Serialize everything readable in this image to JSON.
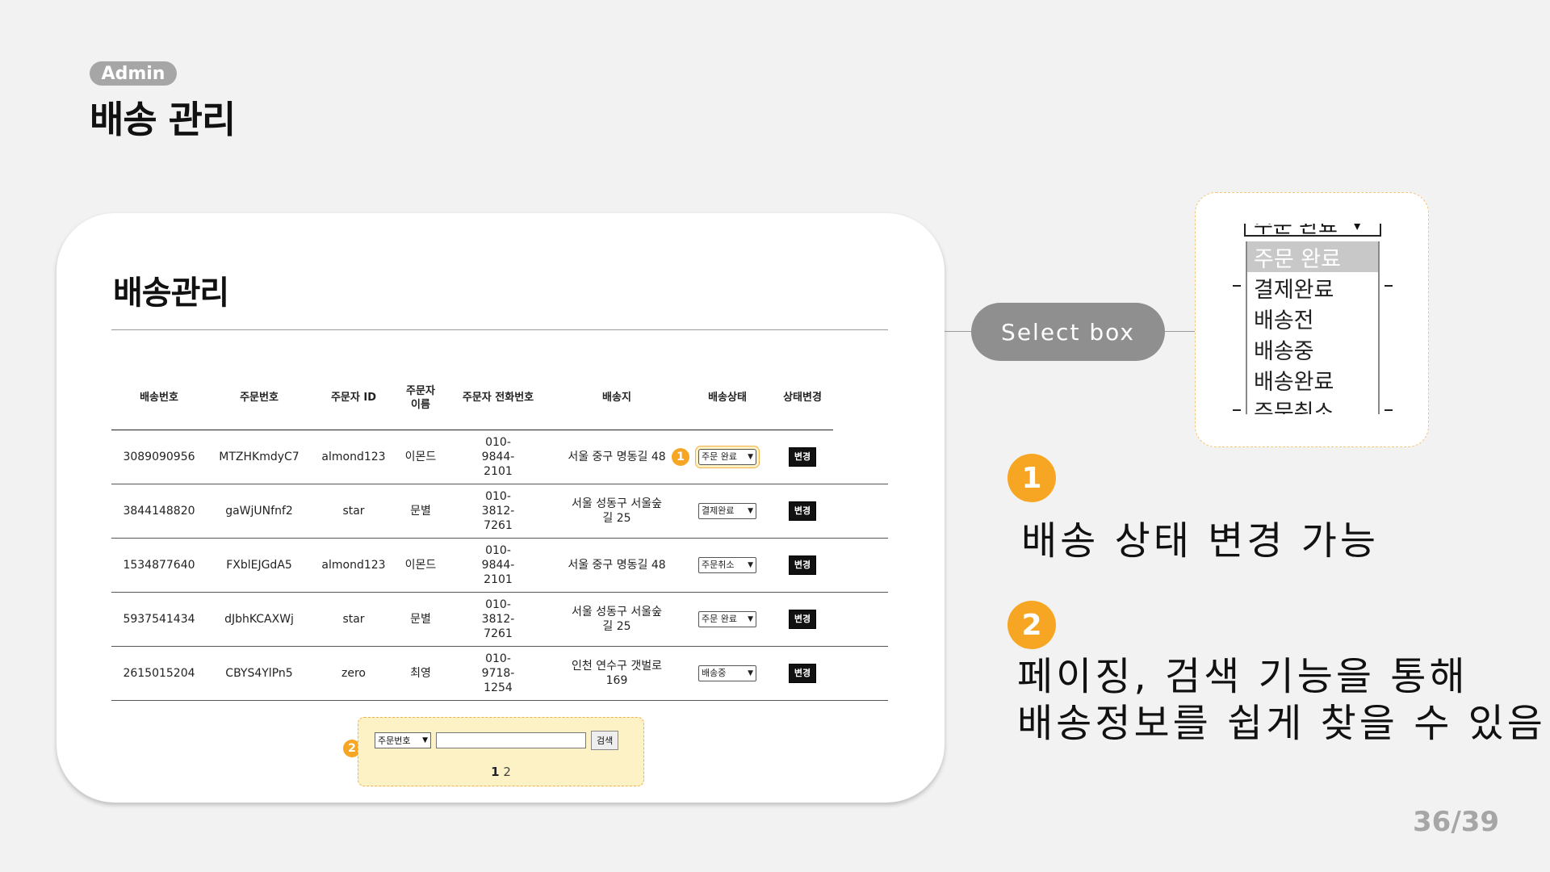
{
  "header": {
    "badge": "Admin",
    "title": "배송 관리"
  },
  "card": {
    "title": "배송관리",
    "columns": [
      "배송번호",
      "주문번호",
      "주문자 ID",
      "주문자 이름",
      "주문자 전화번호",
      "배송지",
      "배송상태",
      "상태변경"
    ],
    "rows": [
      {
        "delivery_no": "3089090956",
        "order_no": "MTZHKmdyC7",
        "user_id": "almond123",
        "name": "이몬드",
        "phone": "010-9844-2101",
        "address": "서울 중구 명동길 48",
        "status": "주문 완료",
        "action": "변경"
      },
      {
        "delivery_no": "3844148820",
        "order_no": "gaWjUNfnf2",
        "user_id": "star",
        "name": "문별",
        "phone": "010-3812-7261",
        "address": "서울 성동구 서울숲길 25",
        "status": "결제완료",
        "action": "변경"
      },
      {
        "delivery_no": "1534877640",
        "order_no": "FXblEJGdA5",
        "user_id": "almond123",
        "name": "이몬드",
        "phone": "010-9844-2101",
        "address": "서울 중구 명동길 48",
        "status": "주문취소",
        "action": "변경"
      },
      {
        "delivery_no": "5937541434",
        "order_no": "dJbhKCAXWj",
        "user_id": "star",
        "name": "문별",
        "phone": "010-3812-7261",
        "address": "서울 성동구 서울숲길 25",
        "status": "주문 완료",
        "action": "변경"
      },
      {
        "delivery_no": "2615015204",
        "order_no": "CBYS4YlPn5",
        "user_id": "zero",
        "name": "최영",
        "phone": "010-9718-1254",
        "address": "인천 연수구 갯벌로 169",
        "status": "배송중",
        "action": "변경"
      }
    ],
    "search": {
      "field_selected": "주문번호",
      "input_value": "",
      "button": "검색"
    },
    "pagination": {
      "current": "1",
      "pages": [
        "2"
      ]
    },
    "markers": {
      "status": "1",
      "search": "2"
    }
  },
  "callout": {
    "label": "Select box",
    "dropdown": {
      "current": "주문 완료",
      "options": [
        "주문 완료",
        "결제완료",
        "배송전",
        "배송중",
        "배송완료",
        "주문취소"
      ]
    }
  },
  "features": [
    {
      "num": "1",
      "text": "배송 상태 변경 가능"
    },
    {
      "num": "2",
      "line1": "페이징, 검색 기능을 통해",
      "line2": "배송정보를 쉽게 찾을 수 있음"
    }
  ],
  "slide_number": "36/39",
  "colors": {
    "accent": "#f6a623",
    "pill": "#8f8f8f",
    "highlight_bg": "#fdf2c5"
  },
  "icons": {
    "select_arrow": "chevron-down-icon"
  }
}
